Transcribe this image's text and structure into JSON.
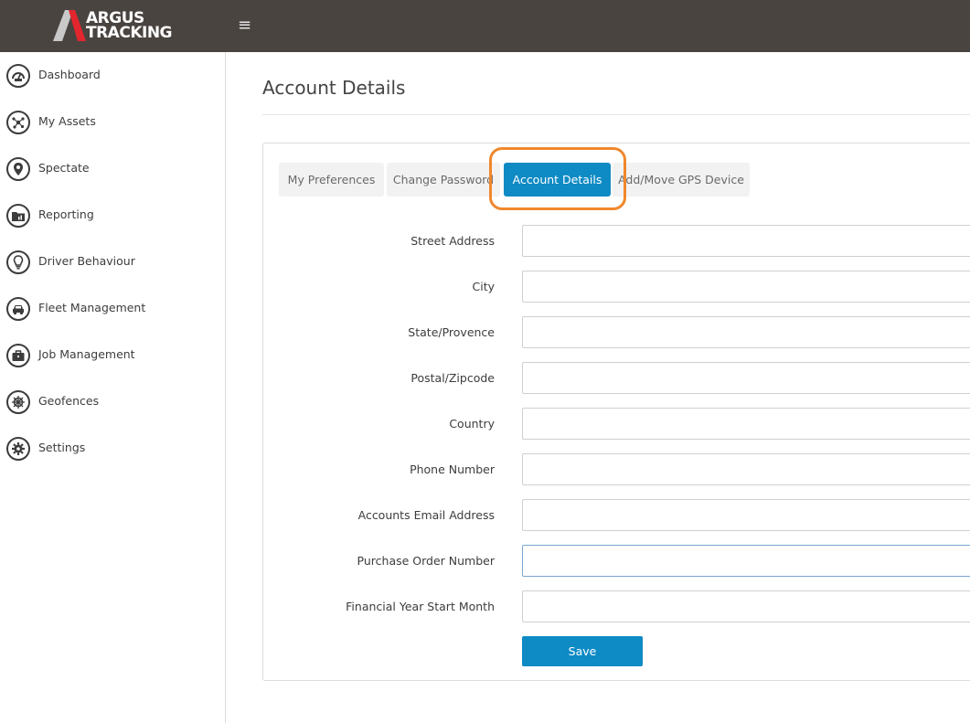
{
  "brand": {
    "line1": "ARGUS",
    "line2": "TRACKING",
    "colors": {
      "header": "#4a4441",
      "accent": "#0e8ac4",
      "logo_red": "#e3262e",
      "highlight": "#f0882d"
    }
  },
  "header": {
    "menu_icon": "hamburger-icon",
    "menu_glyph": "≡"
  },
  "sidebar": {
    "items": [
      {
        "label": "Dashboard",
        "icon": "speedometer-icon"
      },
      {
        "label": "My Assets",
        "icon": "network-icon"
      },
      {
        "label": "Spectate",
        "icon": "map-pin-icon"
      },
      {
        "label": "Reporting",
        "icon": "report-folder-icon"
      },
      {
        "label": "Driver Behaviour",
        "icon": "lightbulb-icon"
      },
      {
        "label": "Fleet Management",
        "icon": "car-icon"
      },
      {
        "label": "Job Management",
        "icon": "briefcase-icon"
      },
      {
        "label": "Geofences",
        "icon": "ship-wheel-icon"
      },
      {
        "label": "Settings",
        "icon": "gear-icon"
      }
    ]
  },
  "main": {
    "title": "Account Details",
    "tabs": [
      {
        "label": "My Preferences",
        "active": false
      },
      {
        "label": "Change Password",
        "active": false
      },
      {
        "label": "Account Details",
        "active": true
      },
      {
        "label": "Add/Move GPS Device",
        "active": false
      }
    ],
    "form": {
      "fields": [
        {
          "label": "Street Address",
          "value": ""
        },
        {
          "label": "City",
          "value": ""
        },
        {
          "label": "State/Provence",
          "value": ""
        },
        {
          "label": "Postal/Zipcode",
          "value": ""
        },
        {
          "label": "Country",
          "value": ""
        },
        {
          "label": "Phone Number",
          "value": ""
        },
        {
          "label": "Accounts Email Address",
          "value": ""
        },
        {
          "label": "Purchase Order Number",
          "value": ""
        },
        {
          "label": "Financial Year Start Month",
          "value": ""
        }
      ],
      "save_label": "Save"
    }
  }
}
